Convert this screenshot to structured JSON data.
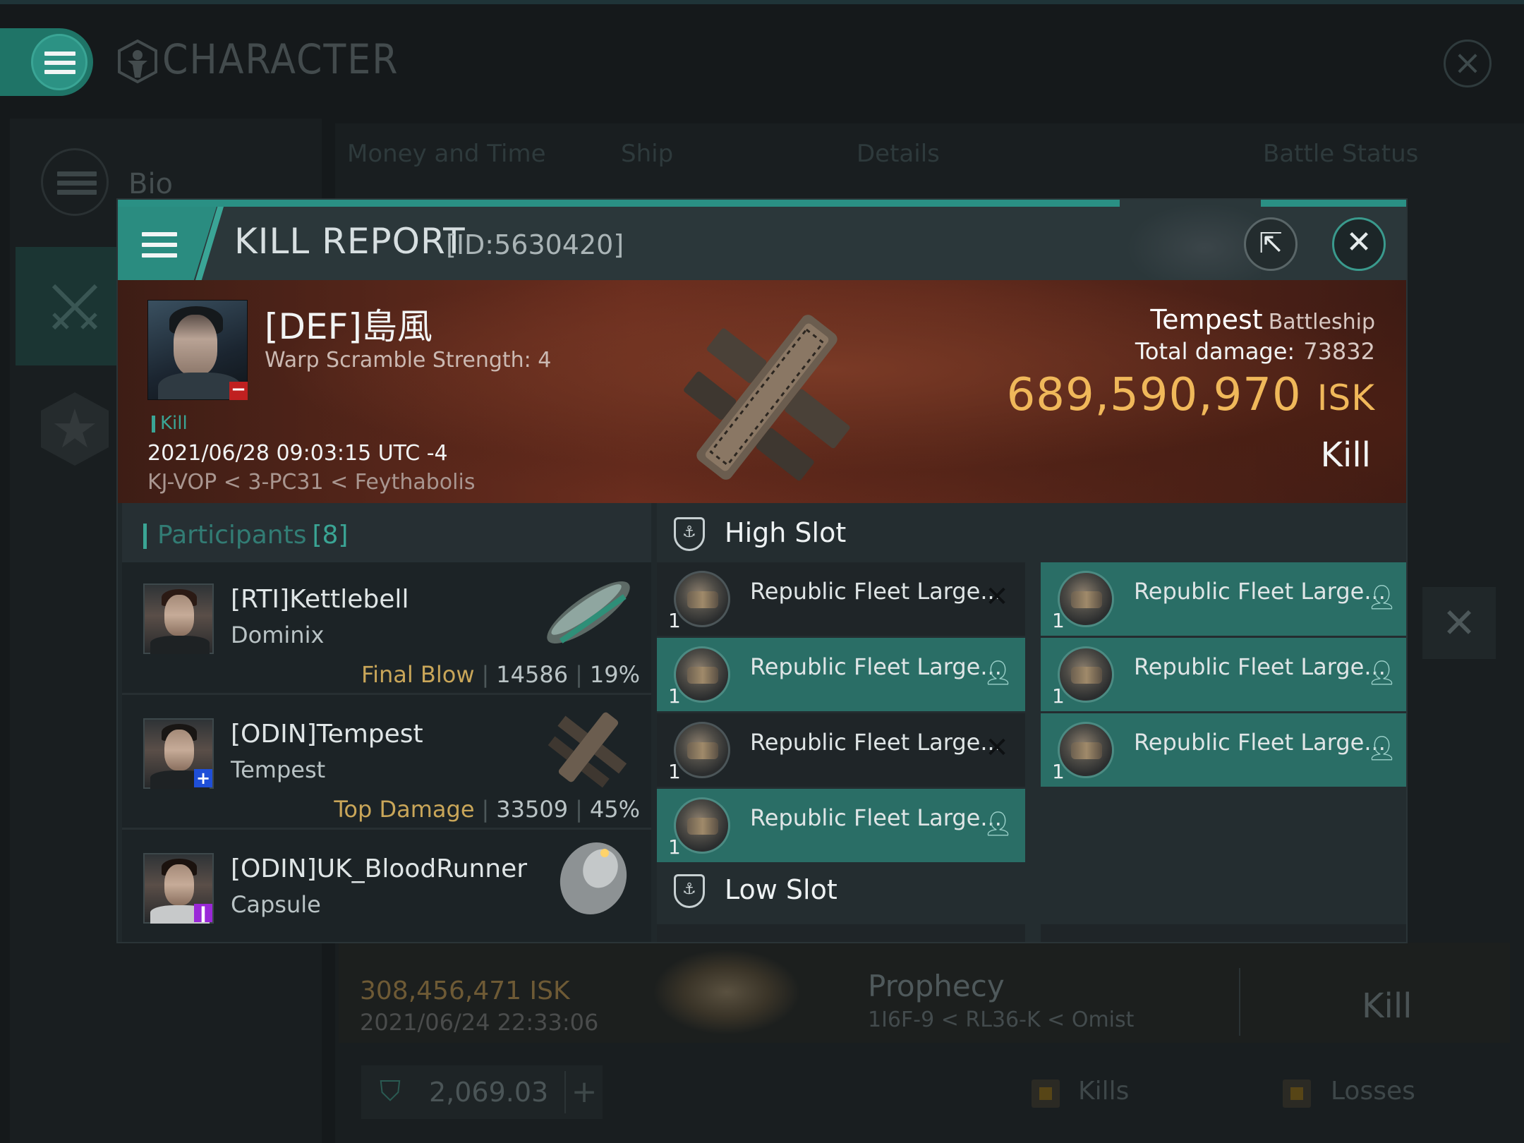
{
  "background": {
    "title": "CHARACTER",
    "sidebar": {
      "bio_label": "Bio"
    },
    "tabs": [
      "Money and Time",
      "Ship",
      "Details",
      "Battle Status"
    ],
    "kill_row": {
      "isk": "308,456,471  ISK",
      "time": "2021/06/24  22:33:06",
      "ship": "Prophecy",
      "location": "1I6F-9 < RL36-K < Omist",
      "type": "Kill"
    },
    "balance": {
      "value": "2,069.03",
      "plus": "+"
    },
    "legend": {
      "kills": "Kills",
      "losses": "Losses"
    }
  },
  "modal": {
    "title": "KILL REPORT",
    "id": "[ID:5630420]",
    "victim": {
      "name": "[DEF]島風",
      "warp": "Warp Scramble Strength: 4",
      "tag": "Kill",
      "time": "2021/06/28 09:03:15 UTC -4",
      "location": "KJ-VOP < 3-PC31 < Feythabolis"
    },
    "ship": {
      "name": "Tempest",
      "class": "Battleship",
      "damage_label": "Total damage:",
      "damage": "73832",
      "isk": "689,590,970",
      "isk_unit": "ISK",
      "type": "Kill"
    },
    "participants": {
      "title": "Participants",
      "count": "[8]",
      "rows": [
        {
          "name": "[RTI]Kettlebell",
          "ship": "Dominix",
          "role": "Final Blow",
          "damage": "14586",
          "percent": "19%"
        },
        {
          "name": "[ODIN]Tempest",
          "ship": "Tempest",
          "role": "Top Damage",
          "damage": "33509",
          "percent": "45%"
        },
        {
          "name": "[ODIN]UK_BloodRunner",
          "ship": "Capsule"
        }
      ]
    },
    "high_slot": {
      "label": "High Slot",
      "modules": [
        {
          "name": "Republic Fleet Large...",
          "qty": "1",
          "state": "destroyed"
        },
        {
          "name": "Republic Fleet Large...",
          "qty": "1",
          "state": "dropped"
        },
        {
          "name": "Republic Fleet Large...",
          "qty": "1",
          "state": "dropped"
        },
        {
          "name": "Republic Fleet Large...",
          "qty": "1",
          "state": "dropped"
        },
        {
          "name": "Republic Fleet Large...",
          "qty": "1",
          "state": "destroyed"
        },
        {
          "name": "Republic Fleet Large...",
          "qty": "1",
          "state": "dropped"
        },
        {
          "name": "Republic Fleet Large...",
          "qty": "1",
          "state": "dropped"
        }
      ]
    },
    "low_slot": {
      "label": "Low Slot"
    }
  }
}
